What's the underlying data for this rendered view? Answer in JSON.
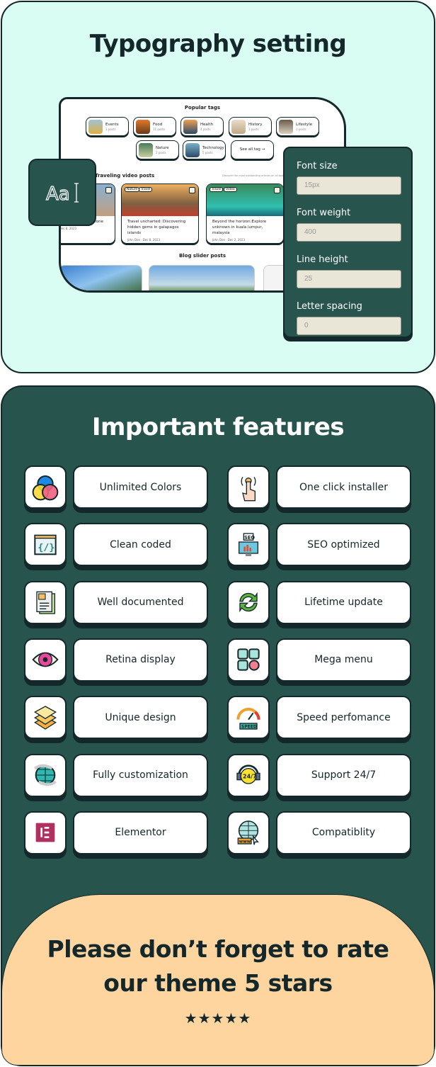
{
  "typography": {
    "title": "Typography setting",
    "aa_icon": "Aa",
    "preview": {
      "popular_tags_title": "Popular tags",
      "tags": [
        {
          "name": "Events",
          "count": "1 posts"
        },
        {
          "name": "Food",
          "count": "11 posts"
        },
        {
          "name": "Health",
          "count": "4 posts"
        },
        {
          "name": "History",
          "count": "1 posts"
        },
        {
          "name": "Lifestyle",
          "count": "1 posts"
        },
        {
          "name": "Nature",
          "count": "2 posts"
        },
        {
          "name": "Technology",
          "count": "5 posts"
        }
      ],
      "see_all": "See all tag →",
      "video_title": "Traveling video posts",
      "video_desc": "Discover the most outstanding articles on all topics",
      "cards": [
        {
          "title": "...gems of archaeological zone",
          "meta": "John Doe · Dec 8, 2023",
          "badges": []
        },
        {
          "title": "Travel uncharted: Discovering hidden gems in galapagos islands",
          "meta": "John Doe · Dec 8, 2023",
          "badges": [
            "Nature",
            "Travel"
          ]
        },
        {
          "title": "Beyond the horizon:Explore unknown in kuala lumpur, malaysia",
          "meta": "John Doe · Dec 2, 2023",
          "badges": [
            "Travel",
            "Video"
          ]
        }
      ],
      "slider_title": "Blog slider posts"
    },
    "settings": [
      {
        "label": "Font size",
        "value": "15px"
      },
      {
        "label": "Font weight",
        "value": "400"
      },
      {
        "label": "Line height",
        "value": "25"
      },
      {
        "label": "Letter spacing",
        "value": "0"
      }
    ]
  },
  "features": {
    "title": "Important features",
    "items": [
      {
        "label": "Unlimited Colors",
        "icon": "color-circles-icon"
      },
      {
        "label": "One click installer",
        "icon": "tap-hand-icon"
      },
      {
        "label": "Clean coded",
        "icon": "code-window-icon"
      },
      {
        "label": "SEO optimized",
        "icon": "seo-monitor-icon"
      },
      {
        "label": "Well documented",
        "icon": "document-icon"
      },
      {
        "label": "Lifetime update",
        "icon": "refresh-icon"
      },
      {
        "label": "Retina display",
        "icon": "eye-icon"
      },
      {
        "label": "Mega menu",
        "icon": "grid-menu-icon"
      },
      {
        "label": "Unique design",
        "icon": "layers-icon"
      },
      {
        "label": "Speed perfomance",
        "icon": "speedometer-icon"
      },
      {
        "label": "Fully customization",
        "icon": "globe-arrows-icon"
      },
      {
        "label": "Support 24/7",
        "icon": "headset-icon"
      },
      {
        "label": "Elementor",
        "icon": "elementor-icon"
      },
      {
        "label": "Compatiblity",
        "icon": "www-globe-icon"
      }
    ]
  },
  "rate": {
    "line1": "Please don’t  forget to rate",
    "line2": "our theme 5 stars",
    "stars": "★★★★★",
    "rating": 5
  },
  "colors": {
    "mint": "#dafdf3",
    "dark_green": "#27544d",
    "peach": "#fed59f",
    "ink": "#14272a"
  }
}
